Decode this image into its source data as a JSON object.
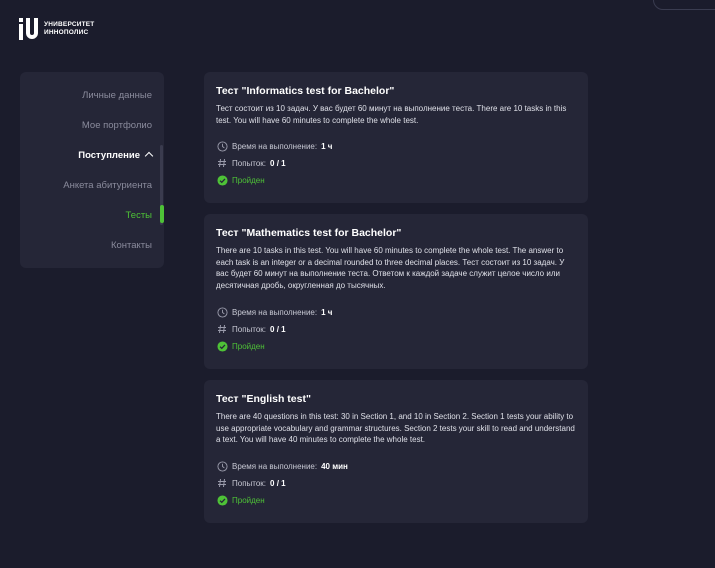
{
  "brand": {
    "name_line1": "УНИВЕРСИТЕТ",
    "name_line2": "ИННОПОЛИС"
  },
  "sidebar": {
    "items": [
      {
        "label": "Личные данные",
        "state": "normal"
      },
      {
        "label": "Мое портфолио",
        "state": "normal"
      },
      {
        "label": "Поступление",
        "state": "expanded"
      },
      {
        "label": "Анкета абитуриента",
        "state": "normal"
      },
      {
        "label": "Тесты",
        "state": "active"
      },
      {
        "label": "Контакты",
        "state": "normal"
      }
    ]
  },
  "tests": [
    {
      "title": "Тест \"Informatics test for Bachelor\"",
      "description": "Тест состоит из 10 задач. У вас будет 60 минут на выполнение теста. There are 10 tasks in this test. You will have 60 minutes to complete the whole test.",
      "time_label": "Время на выполнение:",
      "time_value": "1 ч",
      "attempts_label": "Попыток:",
      "attempts_value": "0 / 1",
      "status": "Пройден"
    },
    {
      "title": "Тест \"Mathematics test for Bachelor\"",
      "description": "There are 10 tasks in this test. You will have 60 minutes to complete the whole test. The answer to each task is an integer or a decimal rounded to three decimal places. Тест состоит из 10 задач. У вас будет 60 минут на выполнение теста. Ответом к каждой задаче служит целое число или десятичная дробь, округленная до тысячных.",
      "time_label": "Время на выполнение:",
      "time_value": "1 ч",
      "attempts_label": "Попыток:",
      "attempts_value": "0 / 1",
      "status": "Пройден"
    },
    {
      "title": "Тест \"English test\"",
      "description": "There are 40 questions in this test: 30 in Section 1, and 10 in Section 2. Section 1 tests your ability to use appropriate vocabulary and grammar structures. Section 2 tests your skill to read and understand a text. You will have 40 minutes to complete the whole test.",
      "time_label": "Время на выполнение:",
      "time_value": "40 мин",
      "attempts_label": "Попыток:",
      "attempts_value": "0 / 1",
      "status": "Пройден"
    }
  ],
  "colors": {
    "background": "#1b1c2c",
    "card": "#252637",
    "accent_green": "#4ec237",
    "muted_text": "#8a8b9c"
  },
  "icons": {
    "time": "clock-icon",
    "attempts": "hash-icon",
    "status": "check-circle-icon",
    "expand": "chevron-up-icon"
  }
}
